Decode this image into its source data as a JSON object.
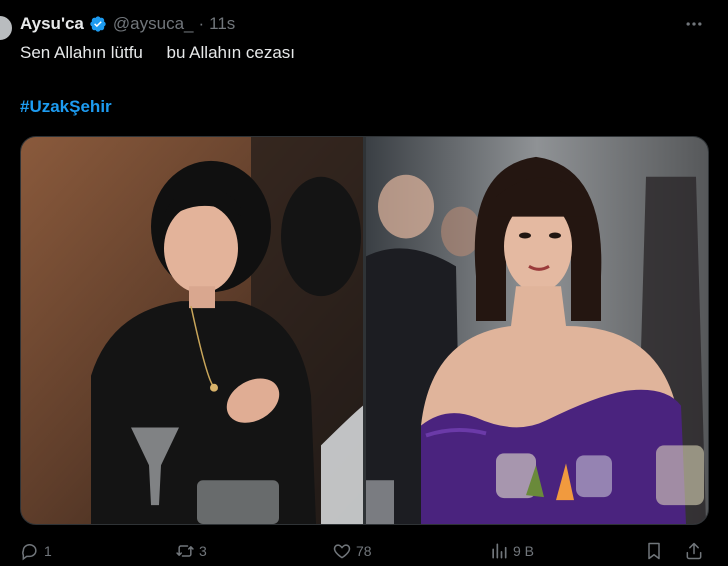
{
  "tweet": {
    "display_name": "Aysu'ca",
    "handle": "@aysuca_",
    "separator": "·",
    "time": "11s",
    "text": "Sen Allahın lütfu     bu Allahın cezası",
    "hashtag": "#UzakŞehir",
    "verified": true
  },
  "media": {
    "images": [
      {
        "icon": "photo-woman-black-dress"
      },
      {
        "icon": "photo-woman-purple-dress"
      }
    ]
  },
  "actions": {
    "reply_count": "1",
    "retweet_count": "3",
    "like_count": "78",
    "views_count": "9 B"
  },
  "colors": {
    "background": "#000000",
    "text": "#e7e9ea",
    "muted": "#71767b",
    "accent": "#1d9bf0"
  }
}
